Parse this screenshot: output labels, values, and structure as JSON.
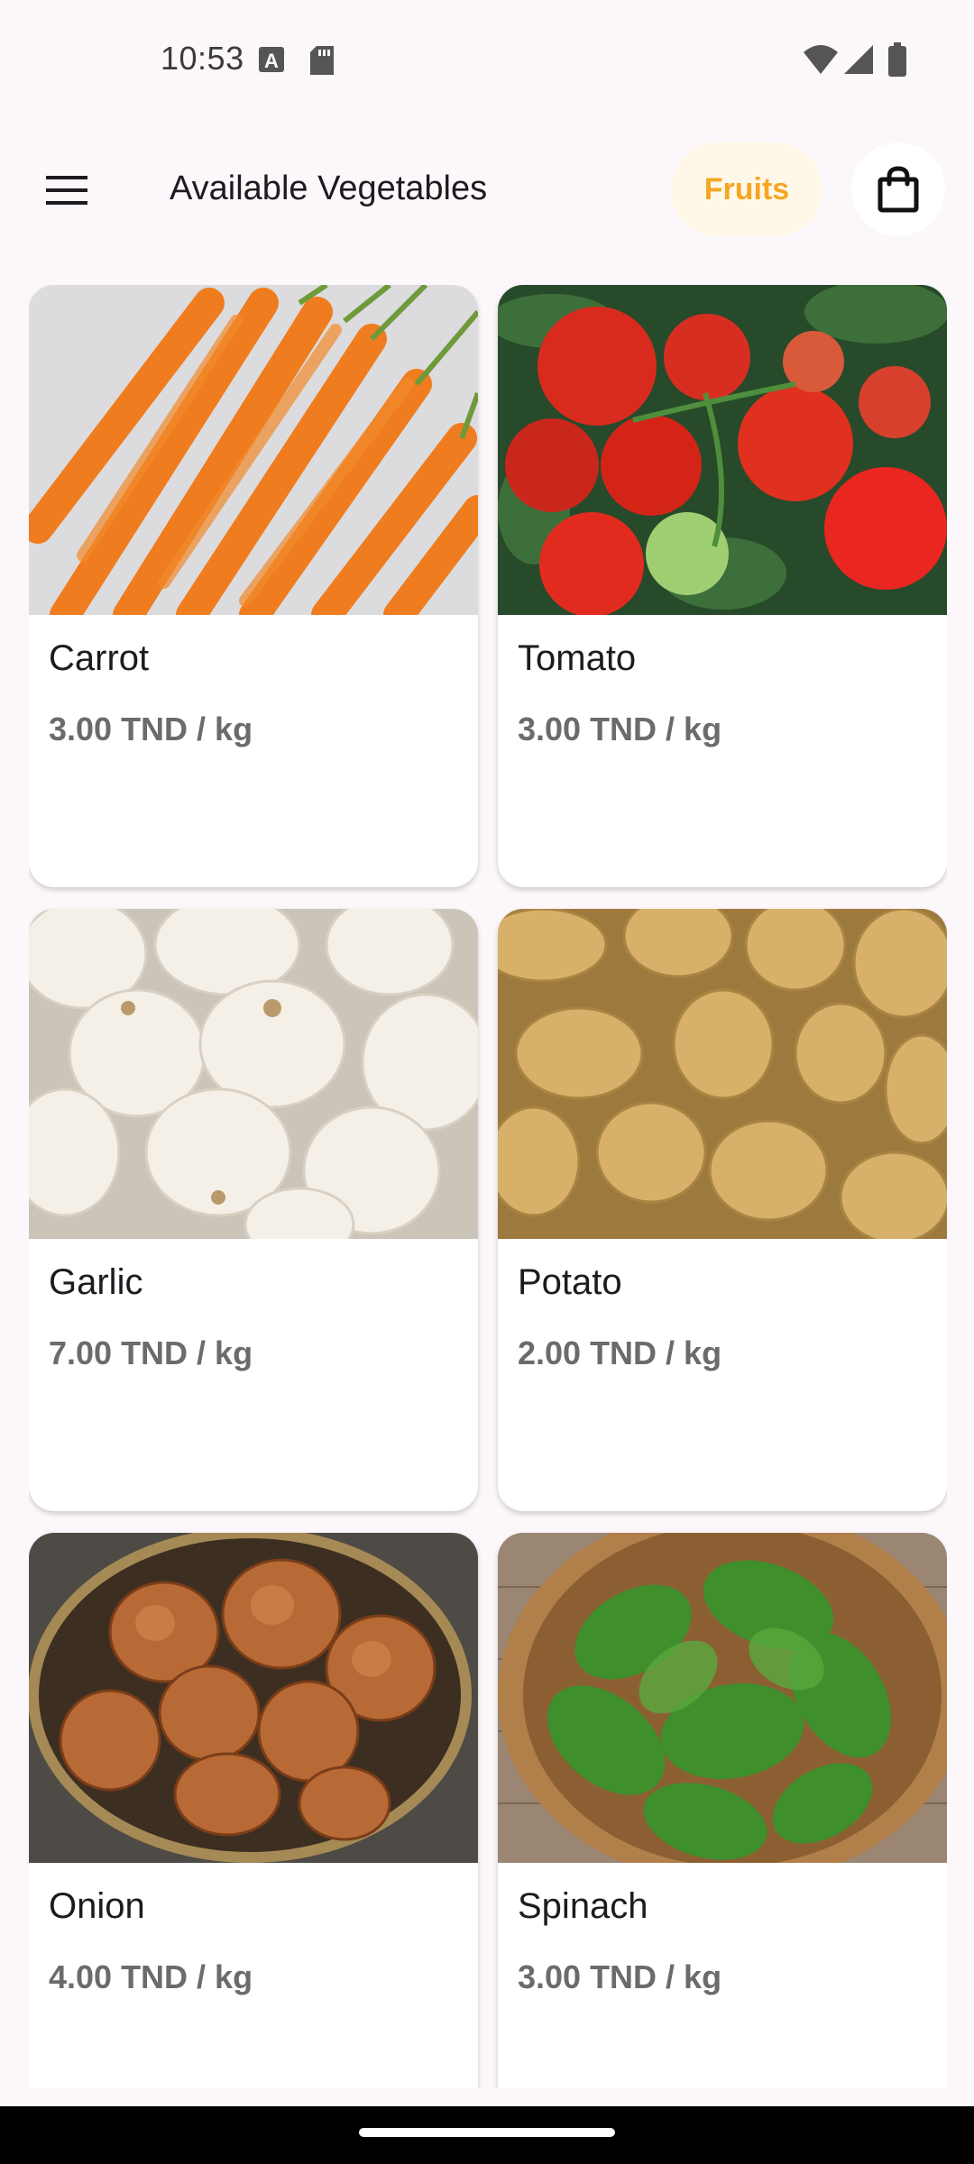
{
  "status": {
    "time": "10:53",
    "left_icons": [
      "a-notification-icon",
      "sd-card-icon"
    ],
    "right_icons": [
      "wifi-icon",
      "cell-signal-icon",
      "battery-icon"
    ]
  },
  "appbar": {
    "menu_icon": "hamburger-menu-icon",
    "title": "Available Vegetables",
    "fruits_label": "Fruits",
    "cart_icon": "shopping-bag-icon"
  },
  "colors": {
    "background": "#fcf7fa",
    "accent": "#f5a623",
    "accent_bg": "#fff8e8",
    "card": "#ffffff",
    "text_primary": "#1d1b20",
    "text_secondary": "#6b6b6b"
  },
  "products": [
    {
      "name": "Carrot",
      "price": "3.00 TND / kg",
      "image": "carrots-photo"
    },
    {
      "name": "Tomato",
      "price": "3.00 TND / kg",
      "image": "tomatoes-photo"
    },
    {
      "name": "Garlic",
      "price": "7.00 TND / kg",
      "image": "garlic-photo"
    },
    {
      "name": "Potato",
      "price": "2.00 TND / kg",
      "image": "potatoes-photo"
    },
    {
      "name": "Onion",
      "price": "4.00 TND / kg",
      "image": "onions-photo"
    },
    {
      "name": "Spinach",
      "price": "3.00 TND / kg",
      "image": "spinach-photo"
    }
  ]
}
